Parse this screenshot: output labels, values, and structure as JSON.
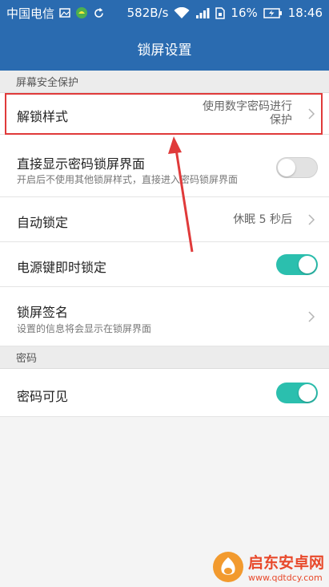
{
  "status_bar": {
    "carrier": "中国电信",
    "speed": "582B/s",
    "battery": "16%",
    "time": "18:46",
    "icons": [
      "image-icon",
      "app-notification-icon",
      "sync-icon",
      "wifi-icon",
      "signal-icon",
      "sim-icon",
      "battery-icon"
    ]
  },
  "title_bar": {
    "title": "锁屏设置"
  },
  "sections": {
    "screen_security": "屏幕安全保护",
    "password": "密码"
  },
  "rows": {
    "unlock_style": {
      "title": "解锁样式",
      "value_line1": "使用数字密码进行",
      "value_line2": "保护"
    },
    "direct_password": {
      "title": "直接显示密码锁屏界面",
      "sub": "开启后不使用其他锁屏样式，直接进入密码锁屏界面",
      "toggle_on": false
    },
    "auto_lock": {
      "title": "自动锁定",
      "value": "休眠 5 秒后"
    },
    "power_key_lock": {
      "title": "电源键即时锁定",
      "toggle_on": true
    },
    "lock_signature": {
      "title": "锁屏签名",
      "sub": "设置的信息将会显示在锁屏界面"
    },
    "password_visible": {
      "title": "密码可见",
      "toggle_on": true
    }
  },
  "watermark": {
    "title": "启东安卓网",
    "url": "www.qdtdcy.com"
  },
  "colors": {
    "header": "#2a6bb0",
    "toggle_on": "#2bbfae",
    "highlight": "#e03a3a"
  }
}
